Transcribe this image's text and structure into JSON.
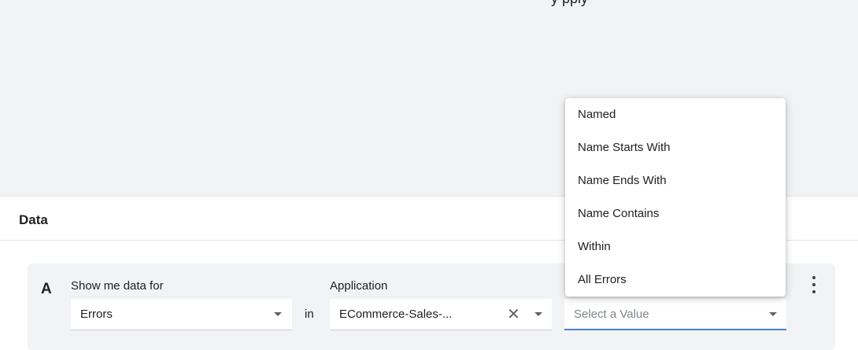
{
  "top_banner": {
    "partial_text": "y          pply"
  },
  "data_section": {
    "title": "Data"
  },
  "query": {
    "letter": "A",
    "show_me_label": "Show me data for",
    "show_me_value": "Errors",
    "in_text": "in",
    "application_label": "Application",
    "application_value": "ECommerce-Sales-...",
    "clear_symbol": "✕",
    "value_placeholder": "Select a Value"
  },
  "dropdown": {
    "items": [
      {
        "label": "Named"
      },
      {
        "label": "Name Starts With"
      },
      {
        "label": "Name Ends With"
      },
      {
        "label": "Name Contains"
      },
      {
        "label": "Within"
      },
      {
        "label": "All Errors"
      }
    ]
  },
  "colors": {
    "page_background": "#ffffff",
    "panel_background": "#f1f3f4",
    "focus_underline": "#4a7fe0"
  }
}
